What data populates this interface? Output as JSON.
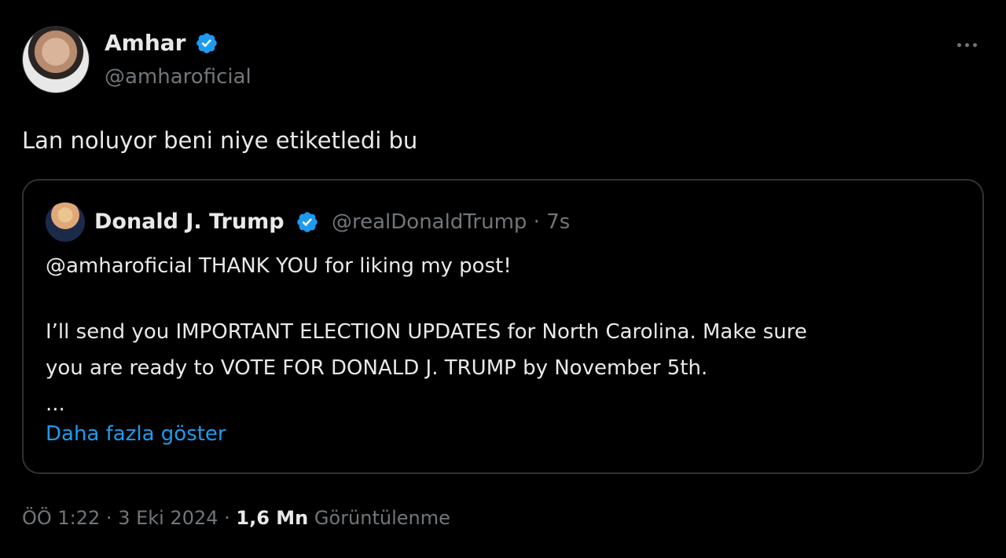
{
  "tweet": {
    "author": {
      "name": "Amhar",
      "handle": "@amharoficial",
      "verified": true
    },
    "text": "Lan noluyor beni niye etiketledi bu",
    "quoted": {
      "author_name": "Donald J. Trump",
      "handle_time": "@realDonaldTrump · 7s",
      "verified": true,
      "line1": "@amharoficial THANK YOU for liking my post!",
      "line2": "I’ll send you IMPORTANT ELECTION UPDATES for North Carolina. Make sure",
      "line3": "you are ready to VOTE FOR DONALD J. TRUMP by November 5th.",
      "ellipsis": "...",
      "show_more": "Daha fazla göster"
    },
    "meta": {
      "time_date": "ÖÖ 1:22 · 3 Eki 2024 · ",
      "views_count": "1,6 Mn",
      "views_label": "Görüntülenme"
    }
  },
  "colors": {
    "background": "#000000",
    "text": "#e7e9ea",
    "secondary_text": "#71767b",
    "link": "#1d9bf0",
    "verified_badge": "#1d9bf0",
    "card_border": "#2f3336"
  },
  "icons": {
    "verified": "verified-badge-icon",
    "more": "more-horizontal-icon"
  }
}
